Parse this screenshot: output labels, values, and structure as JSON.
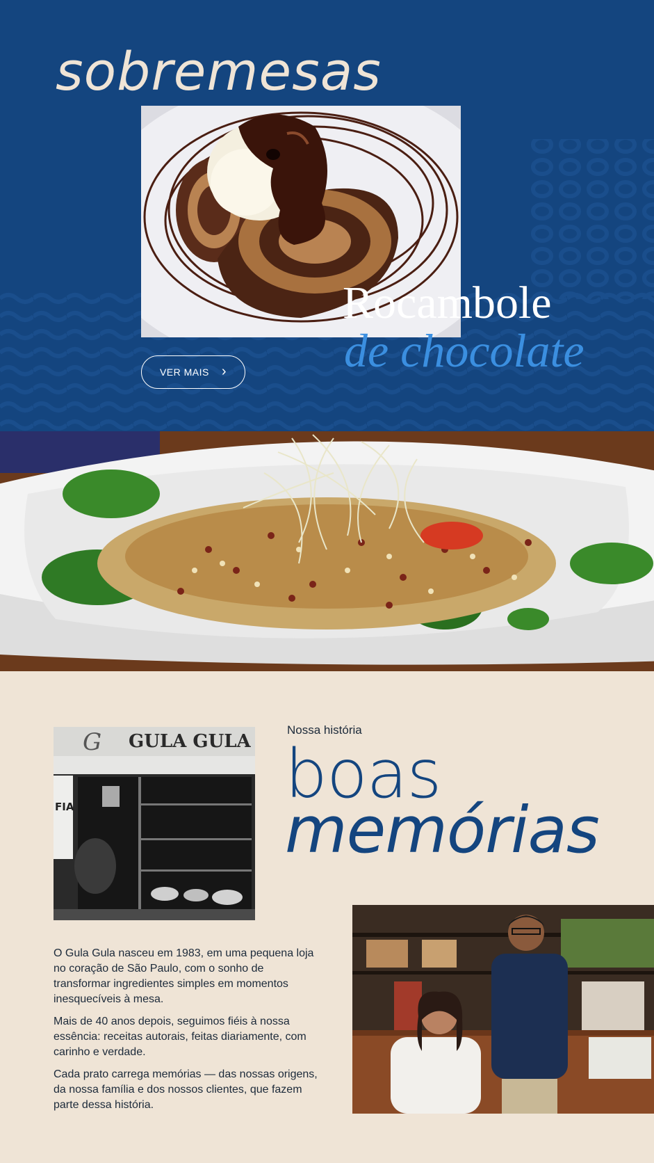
{
  "hero": {
    "section_title": "sobremesas",
    "dish_name_line1": "Rocambole",
    "dish_name_line2": "de chocolate",
    "cta_label": "VER MAIS",
    "cta_icon": "chevron-right-icon"
  },
  "story": {
    "eyebrow": "Nossa história",
    "title_line1": "boas",
    "title_line2": "memórias",
    "store_sign": "GULA GULA",
    "paragraphs": [
      "O Gula Gula nasceu em 1983, em uma pequena loja no coração de São Paulo, com o sonho de transformar ingredientes simples em momentos inesquecíveis à mesa.",
      "Mais de 40 anos depois, seguimos fiéis à nossa essência: receitas autorais, feitas diariamente, com carinho e verdade.",
      "Cada prato carrega memórias — das nossas origens, da nossa família e dos nossos clientes, que fazem parte dessa história."
    ]
  },
  "colors": {
    "hero_bg": "#14457f",
    "accent_blue": "#3b8fe0",
    "cream_bg": "#efe4d6",
    "title_blue": "#14457f"
  }
}
